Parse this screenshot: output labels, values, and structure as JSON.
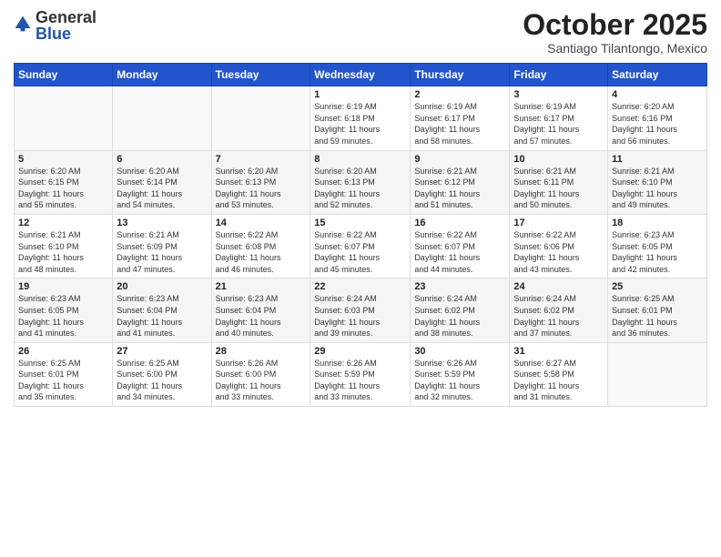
{
  "header": {
    "logo_general": "General",
    "logo_blue": "Blue",
    "month_title": "October 2025",
    "location": "Santiago Tilantongo, Mexico"
  },
  "days_of_week": [
    "Sunday",
    "Monday",
    "Tuesday",
    "Wednesday",
    "Thursday",
    "Friday",
    "Saturday"
  ],
  "weeks": [
    {
      "days": [
        {
          "num": "",
          "info": ""
        },
        {
          "num": "",
          "info": ""
        },
        {
          "num": "",
          "info": ""
        },
        {
          "num": "1",
          "info": "Sunrise: 6:19 AM\nSunset: 6:18 PM\nDaylight: 11 hours\nand 59 minutes."
        },
        {
          "num": "2",
          "info": "Sunrise: 6:19 AM\nSunset: 6:17 PM\nDaylight: 11 hours\nand 58 minutes."
        },
        {
          "num": "3",
          "info": "Sunrise: 6:19 AM\nSunset: 6:17 PM\nDaylight: 11 hours\nand 57 minutes."
        },
        {
          "num": "4",
          "info": "Sunrise: 6:20 AM\nSunset: 6:16 PM\nDaylight: 11 hours\nand 56 minutes."
        }
      ]
    },
    {
      "days": [
        {
          "num": "5",
          "info": "Sunrise: 6:20 AM\nSunset: 6:15 PM\nDaylight: 11 hours\nand 55 minutes."
        },
        {
          "num": "6",
          "info": "Sunrise: 6:20 AM\nSunset: 6:14 PM\nDaylight: 11 hours\nand 54 minutes."
        },
        {
          "num": "7",
          "info": "Sunrise: 6:20 AM\nSunset: 6:13 PM\nDaylight: 11 hours\nand 53 minutes."
        },
        {
          "num": "8",
          "info": "Sunrise: 6:20 AM\nSunset: 6:13 PM\nDaylight: 11 hours\nand 52 minutes."
        },
        {
          "num": "9",
          "info": "Sunrise: 6:21 AM\nSunset: 6:12 PM\nDaylight: 11 hours\nand 51 minutes."
        },
        {
          "num": "10",
          "info": "Sunrise: 6:21 AM\nSunset: 6:11 PM\nDaylight: 11 hours\nand 50 minutes."
        },
        {
          "num": "11",
          "info": "Sunrise: 6:21 AM\nSunset: 6:10 PM\nDaylight: 11 hours\nand 49 minutes."
        }
      ]
    },
    {
      "days": [
        {
          "num": "12",
          "info": "Sunrise: 6:21 AM\nSunset: 6:10 PM\nDaylight: 11 hours\nand 48 minutes."
        },
        {
          "num": "13",
          "info": "Sunrise: 6:21 AM\nSunset: 6:09 PM\nDaylight: 11 hours\nand 47 minutes."
        },
        {
          "num": "14",
          "info": "Sunrise: 6:22 AM\nSunset: 6:08 PM\nDaylight: 11 hours\nand 46 minutes."
        },
        {
          "num": "15",
          "info": "Sunrise: 6:22 AM\nSunset: 6:07 PM\nDaylight: 11 hours\nand 45 minutes."
        },
        {
          "num": "16",
          "info": "Sunrise: 6:22 AM\nSunset: 6:07 PM\nDaylight: 11 hours\nand 44 minutes."
        },
        {
          "num": "17",
          "info": "Sunrise: 6:22 AM\nSunset: 6:06 PM\nDaylight: 11 hours\nand 43 minutes."
        },
        {
          "num": "18",
          "info": "Sunrise: 6:23 AM\nSunset: 6:05 PM\nDaylight: 11 hours\nand 42 minutes."
        }
      ]
    },
    {
      "days": [
        {
          "num": "19",
          "info": "Sunrise: 6:23 AM\nSunset: 6:05 PM\nDaylight: 11 hours\nand 41 minutes."
        },
        {
          "num": "20",
          "info": "Sunrise: 6:23 AM\nSunset: 6:04 PM\nDaylight: 11 hours\nand 41 minutes."
        },
        {
          "num": "21",
          "info": "Sunrise: 6:23 AM\nSunset: 6:04 PM\nDaylight: 11 hours\nand 40 minutes."
        },
        {
          "num": "22",
          "info": "Sunrise: 6:24 AM\nSunset: 6:03 PM\nDaylight: 11 hours\nand 39 minutes."
        },
        {
          "num": "23",
          "info": "Sunrise: 6:24 AM\nSunset: 6:02 PM\nDaylight: 11 hours\nand 38 minutes."
        },
        {
          "num": "24",
          "info": "Sunrise: 6:24 AM\nSunset: 6:02 PM\nDaylight: 11 hours\nand 37 minutes."
        },
        {
          "num": "25",
          "info": "Sunrise: 6:25 AM\nSunset: 6:01 PM\nDaylight: 11 hours\nand 36 minutes."
        }
      ]
    },
    {
      "days": [
        {
          "num": "26",
          "info": "Sunrise: 6:25 AM\nSunset: 6:01 PM\nDaylight: 11 hours\nand 35 minutes."
        },
        {
          "num": "27",
          "info": "Sunrise: 6:25 AM\nSunset: 6:00 PM\nDaylight: 11 hours\nand 34 minutes."
        },
        {
          "num": "28",
          "info": "Sunrise: 6:26 AM\nSunset: 6:00 PM\nDaylight: 11 hours\nand 33 minutes."
        },
        {
          "num": "29",
          "info": "Sunrise: 6:26 AM\nSunset: 5:59 PM\nDaylight: 11 hours\nand 33 minutes."
        },
        {
          "num": "30",
          "info": "Sunrise: 6:26 AM\nSunset: 5:59 PM\nDaylight: 11 hours\nand 32 minutes."
        },
        {
          "num": "31",
          "info": "Sunrise: 6:27 AM\nSunset: 5:58 PM\nDaylight: 11 hours\nand 31 minutes."
        },
        {
          "num": "",
          "info": ""
        }
      ]
    }
  ]
}
